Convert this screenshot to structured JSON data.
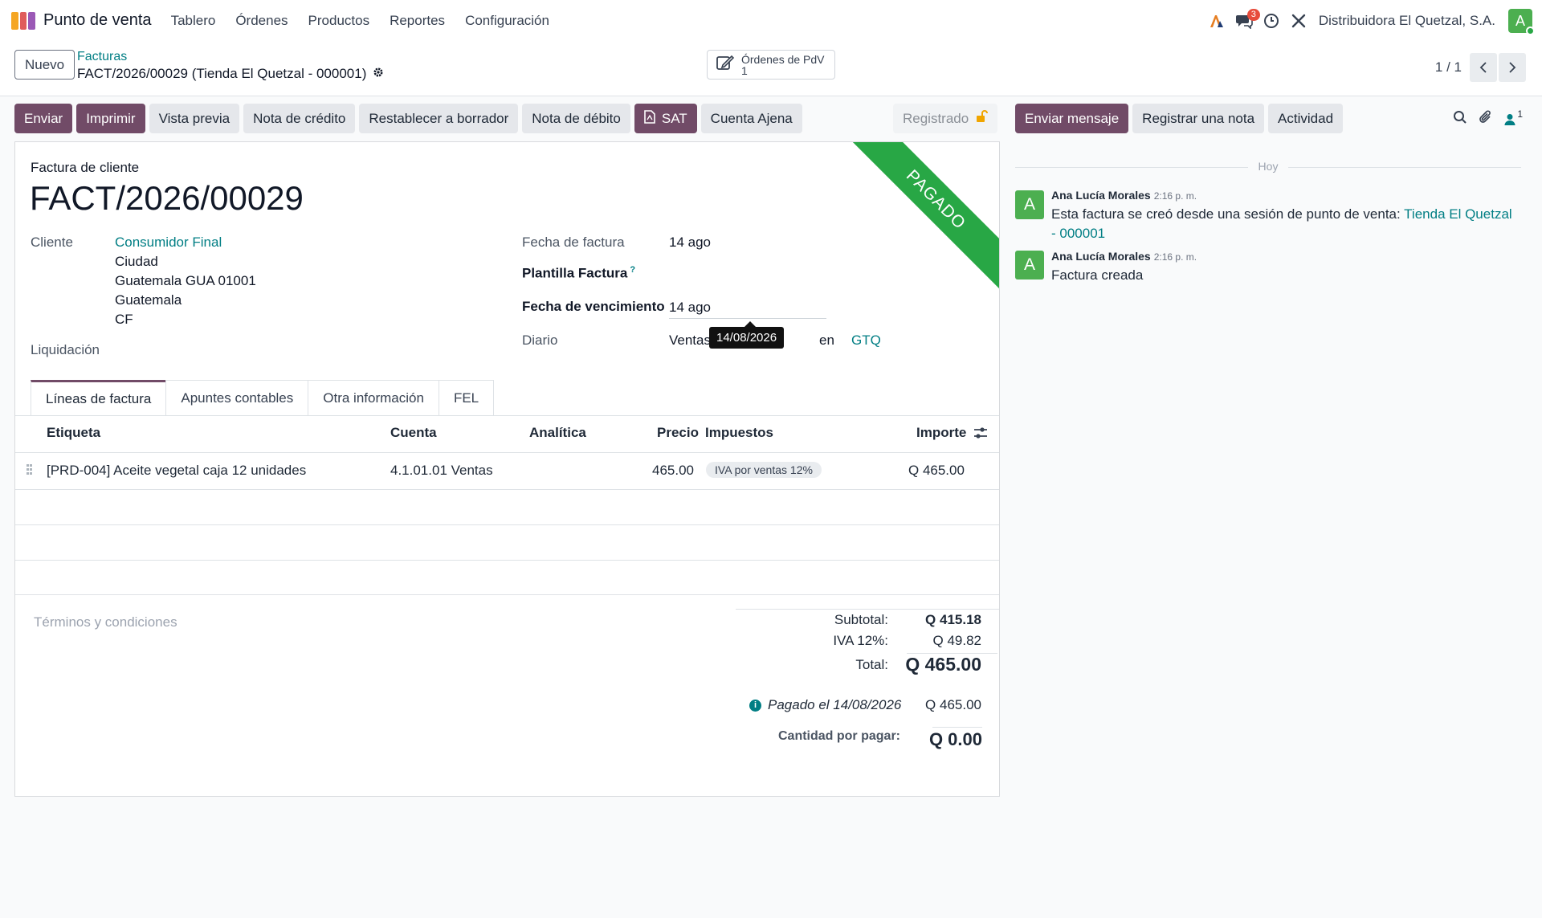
{
  "navbar": {
    "app_name": "Punto de venta",
    "menu": [
      "Tablero",
      "Órdenes",
      "Productos",
      "Reportes",
      "Configuración"
    ],
    "chat_badge": "3",
    "company": "Distribuidora El Quetzal, S.A.",
    "user_initial": "A"
  },
  "control": {
    "new_label": "Nuevo",
    "breadcrumb_parent": "Facturas",
    "breadcrumb_current": "FACT/2026/00029 (Tienda El Quetzal - 000001)",
    "smart_button_label": "Órdenes de PdV",
    "smart_button_count": "1",
    "pager": "1 / 1"
  },
  "actions": {
    "send": "Enviar",
    "print": "Imprimir",
    "preview": "Vista previa",
    "credit_note": "Nota de crédito",
    "reset_draft": "Restablecer a borrador",
    "debit_note": "Nota de débito",
    "sat": "SAT",
    "foreign_account": "Cuenta Ajena",
    "status": "Registrado"
  },
  "invoice": {
    "ribbon": "PAGADO",
    "subtitle": "Factura de cliente",
    "number": "FACT/2026/00029",
    "customer_label": "Cliente",
    "customer_name": "Consumidor Final",
    "address": [
      "Ciudad",
      "Guatemala GUA 01001",
      "Guatemala",
      "CF"
    ],
    "settlement_label": "Liquidación",
    "invoice_date_label": "Fecha de factura",
    "invoice_date": "14 ago",
    "template_label": "Plantilla Factura",
    "template_help": "?",
    "due_date_label": "Fecha de vencimiento",
    "due_date": "14 ago",
    "journal_label": "Diario",
    "journal": "Ventas",
    "currency_in": "en",
    "currency": "GTQ",
    "tooltip": "14/08/2026"
  },
  "tabs": [
    "Líneas de factura",
    "Apuntes contables",
    "Otra información",
    "FEL"
  ],
  "lines": {
    "headers": {
      "label": "Etiqueta",
      "account": "Cuenta",
      "analytic": "Analítica",
      "price": "Precio",
      "taxes": "Impuestos",
      "amount": "Importe"
    },
    "rows": [
      {
        "label": "[PRD-004] Aceite vegetal caja 12 unidades",
        "account": "4.1.01.01 Ventas",
        "price": "465.00",
        "tax": "IVA por ventas 12%",
        "amount": "Q 465.00"
      }
    ]
  },
  "totals": {
    "terms_placeholder": "Términos y condiciones",
    "subtotal_label": "Subtotal:",
    "subtotal": "Q 415.18",
    "iva_label": "IVA 12%:",
    "iva": "Q 49.82",
    "total_label": "Total:",
    "total": "Q 465.00",
    "paid_label": "Pagado el 14/08/2026",
    "paid_amount": "Q 465.00",
    "due_label": "Cantidad por pagar:",
    "due": "Q 0.00"
  },
  "chatter": {
    "send_message": "Enviar mensaje",
    "log_note": "Registrar una nota",
    "activity": "Actividad",
    "followers_count": "1",
    "today": "Hoy",
    "messages": [
      {
        "avatar": "A",
        "author": "Ana Lucía Morales",
        "time": "2:16 p. m.",
        "text": "Esta factura se creó desde una sesión de punto de venta:",
        "link": "Tienda El Quetzal - 000001"
      },
      {
        "avatar": "A",
        "author": "Ana Lucía Morales",
        "time": "2:16 p. m.",
        "text": "Factura creada"
      }
    ]
  },
  "colors": {
    "primary": "#714b67",
    "link": "#017e84",
    "paid_ribbon": "#28a745"
  }
}
